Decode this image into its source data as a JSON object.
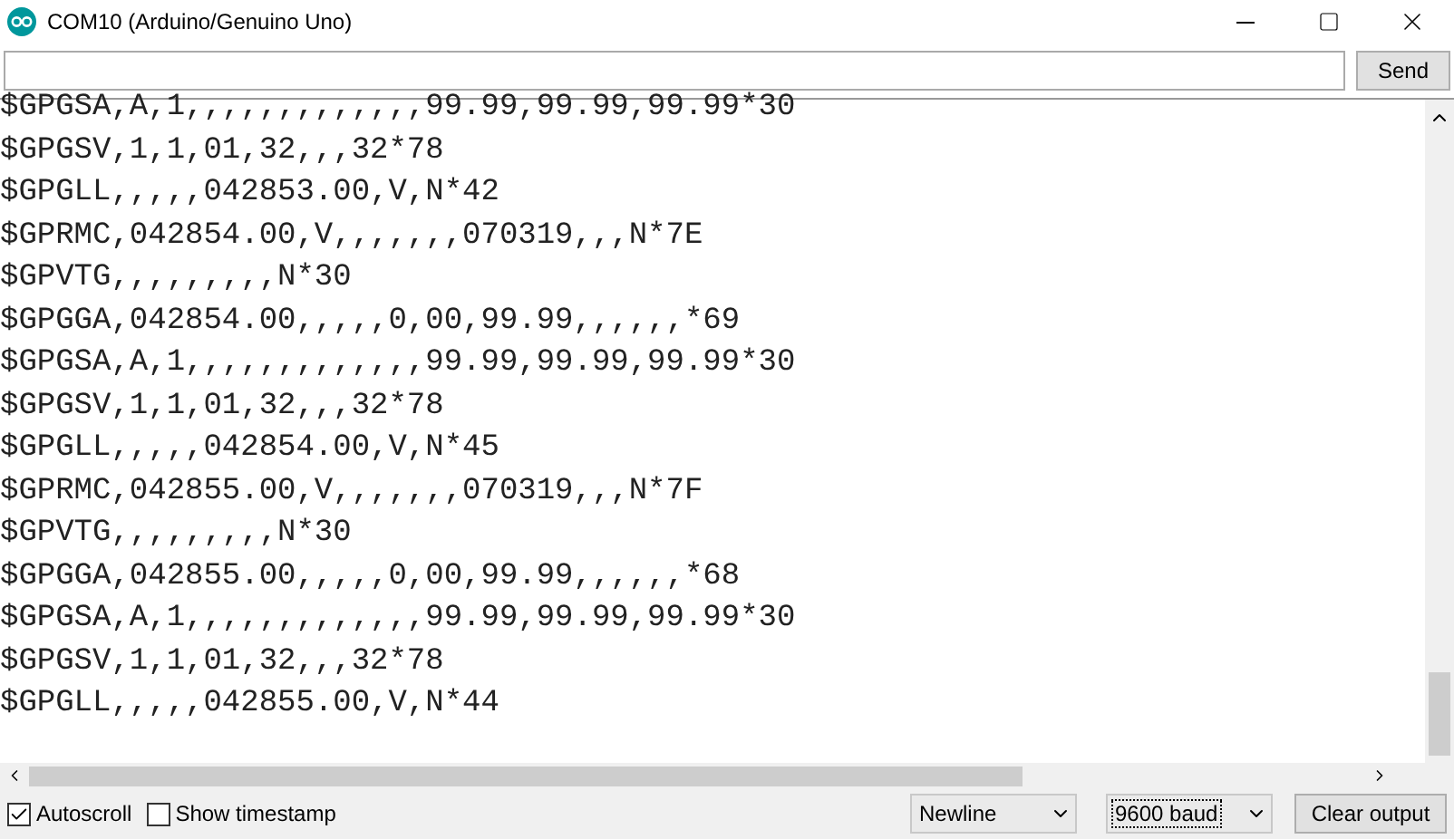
{
  "window": {
    "title": "COM10 (Arduino/Genuino Uno)"
  },
  "send_button": "Send",
  "output_lines": [
    "$GPGSA,A,1,,,,,,,,,,,,,99.99,99.99,99.99*30",
    "$GPGSV,1,1,01,32,,,32*78",
    "$GPGLL,,,,,042853.00,V,N*42",
    "$GPRMC,042854.00,V,,,,,,,070319,,,N*7E",
    "$GPVTG,,,,,,,,,N*30",
    "$GPGGA,042854.00,,,,,0,00,99.99,,,,,,*69",
    "$GPGSA,A,1,,,,,,,,,,,,,99.99,99.99,99.99*30",
    "$GPGSV,1,1,01,32,,,32*78",
    "$GPGLL,,,,,042854.00,V,N*45",
    "$GPRMC,042855.00,V,,,,,,,070319,,,N*7F",
    "$GPVTG,,,,,,,,,N*30",
    "$GPGGA,042855.00,,,,,0,00,99.99,,,,,,*68",
    "$GPGSA,A,1,,,,,,,,,,,,,99.99,99.99,99.99*30",
    "$GPGSV,1,1,01,32,,,32*78",
    "$GPGLL,,,,,042855.00,V,N*44"
  ],
  "options": [
    {
      "label": "Autoscroll",
      "checked": true
    },
    {
      "label": "Show timestamp",
      "checked": false
    }
  ],
  "line_ending": {
    "value": "Newline",
    "focused": false
  },
  "baud_rate": {
    "value": "9600 baud",
    "focused": true
  },
  "clear_button": "Clear output"
}
